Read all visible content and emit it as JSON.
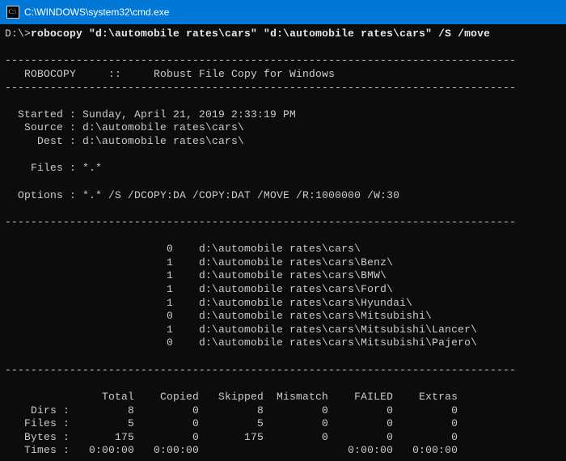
{
  "window": {
    "title": "C:\\WINDOWS\\system32\\cmd.exe"
  },
  "prompt": "D:\\>",
  "command": "robocopy \"d:\\automobile rates\\cars\" \"d:\\automobile rates\\cars\" /S /move",
  "dashline": "-------------------------------------------------------------------------------",
  "header": "   ROBOCOPY     ::     Robust File Copy for Windows",
  "info": {
    "started_label": "  Started :",
    "started_value": " Sunday, April 21, 2019 2:33:19 PM",
    "source_label": "   Source :",
    "source_value": " d:\\automobile rates\\cars\\",
    "dest_label": "     Dest :",
    "dest_value": " d:\\automobile rates\\cars\\",
    "files_label": "    Files :",
    "files_value": " *.*",
    "options_label": "  Options :",
    "options_value": " *.* /S /DCOPY:DA /COPY:DAT /MOVE /R:1000000 /W:30"
  },
  "listing": [
    {
      "n": "0",
      "path": "d:\\automobile rates\\cars\\"
    },
    {
      "n": "1",
      "path": "d:\\automobile rates\\cars\\Benz\\"
    },
    {
      "n": "1",
      "path": "d:\\automobile rates\\cars\\BMW\\"
    },
    {
      "n": "1",
      "path": "d:\\automobile rates\\cars\\Ford\\"
    },
    {
      "n": "1",
      "path": "d:\\automobile rates\\cars\\Hyundai\\"
    },
    {
      "n": "0",
      "path": "d:\\automobile rates\\cars\\Mitsubishi\\"
    },
    {
      "n": "1",
      "path": "d:\\automobile rates\\cars\\Mitsubishi\\Lancer\\"
    },
    {
      "n": "0",
      "path": "d:\\automobile rates\\cars\\Mitsubishi\\Pajero\\"
    }
  ],
  "summary": {
    "cols": "               Total    Copied   Skipped  Mismatch    FAILED    Extras",
    "rows": [
      "    Dirs :         8         0         8         0         0         0",
      "   Files :         5         0         5         0         0         0",
      "   Bytes :       175         0       175         0         0         0",
      "   Times :   0:00:00   0:00:00                       0:00:00   0:00:00"
    ]
  }
}
